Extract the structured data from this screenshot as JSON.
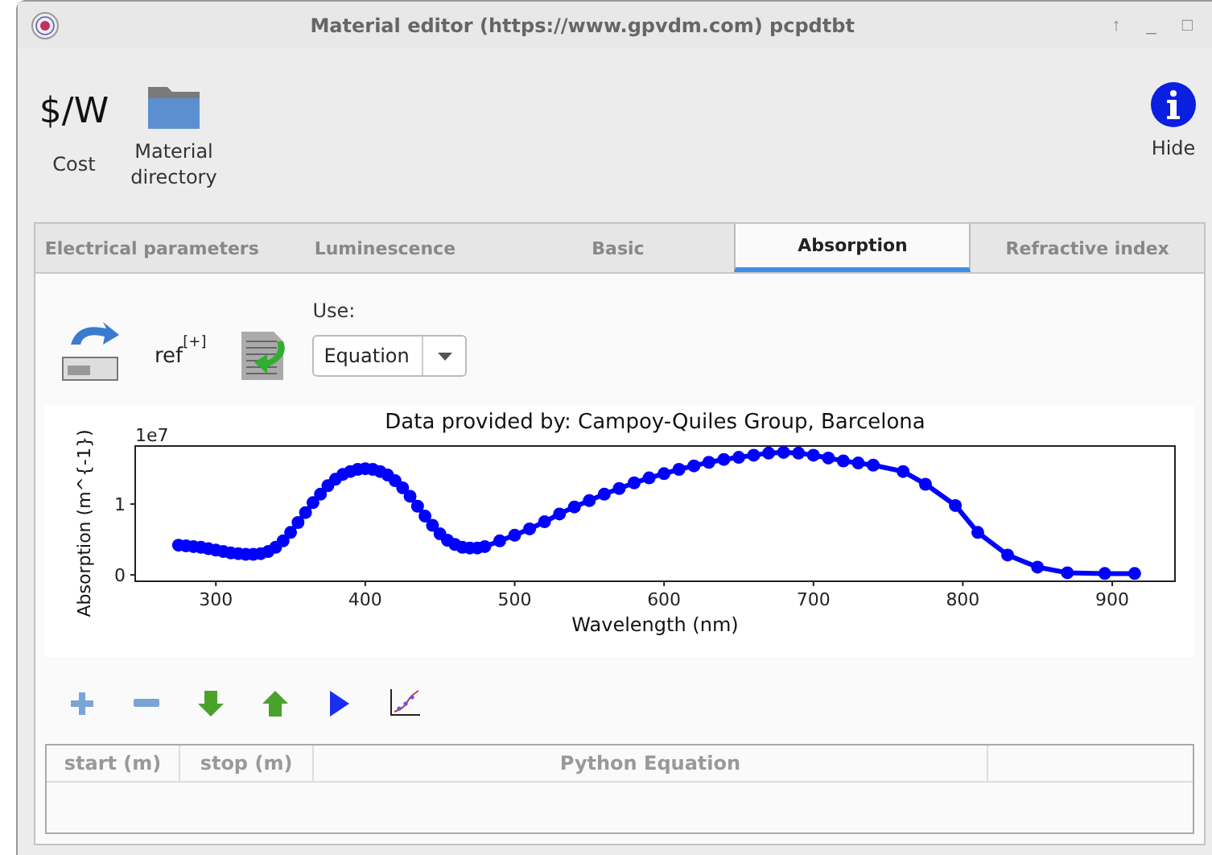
{
  "window": {
    "title": "Material editor (https://www.gpvdm.com) pcpdtbt",
    "controls": [
      "↑",
      "_",
      "□"
    ]
  },
  "toolbar": {
    "items": [
      {
        "kind": "text",
        "glyph": "$/W",
        "label": "Cost"
      },
      {
        "kind": "folder",
        "label": "Material\ndirectory"
      },
      {
        "kind": "info",
        "label": "Hide"
      }
    ]
  },
  "tabs": [
    {
      "label": "Electrical parameters",
      "selected": false
    },
    {
      "label": "Luminescence",
      "selected": false
    },
    {
      "label": "Basic",
      "selected": false
    },
    {
      "label": "Absorption",
      "selected": true
    },
    {
      "label": "Refractive index",
      "selected": false
    }
  ],
  "absorption": {
    "ref": {
      "label": "ref",
      "mark": "[+]"
    },
    "use": {
      "label": "Use:",
      "value": "Equation"
    },
    "chart_data": {
      "type": "line",
      "title": "Data provided by: Campoy-Quiles Group, Barcelona",
      "xlabel": "Wavelength (nm)",
      "ylabel": "Absorption (m^{-1})",
      "xlim": [
        246,
        942
      ],
      "ylim": [
        -0.09,
        1.82
      ],
      "xticks": [
        300,
        400,
        500,
        600,
        700,
        800,
        900
      ],
      "yticks": [
        {
          "value": 0,
          "label": "0"
        },
        {
          "value": 1,
          "label": "1"
        }
      ],
      "annotations": [
        "1e7"
      ],
      "x": [
        275,
        280,
        285,
        290,
        295,
        300,
        305,
        310,
        315,
        320,
        325,
        330,
        335,
        340,
        345,
        350,
        355,
        360,
        365,
        370,
        375,
        380,
        385,
        390,
        395,
        400,
        405,
        410,
        415,
        420,
        425,
        430,
        435,
        440,
        445,
        450,
        455,
        460,
        465,
        470,
        475,
        480,
        490,
        500,
        510,
        520,
        530,
        540,
        550,
        560,
        570,
        580,
        590,
        600,
        610,
        620,
        630,
        640,
        650,
        660,
        670,
        680,
        690,
        700,
        710,
        720,
        730,
        740,
        760,
        775,
        795,
        810,
        830,
        850,
        870,
        895,
        915
      ],
      "series": [
        {
          "color": "#0000ff",
          "marker": "o",
          "values": [
            0.42,
            0.41,
            0.4,
            0.39,
            0.37,
            0.35,
            0.33,
            0.31,
            0.3,
            0.29,
            0.29,
            0.3,
            0.33,
            0.39,
            0.48,
            0.6,
            0.74,
            0.88,
            1.02,
            1.14,
            1.26,
            1.35,
            1.42,
            1.46,
            1.49,
            1.5,
            1.49,
            1.46,
            1.41,
            1.33,
            1.23,
            1.11,
            0.97,
            0.83,
            0.7,
            0.58,
            0.49,
            0.43,
            0.39,
            0.38,
            0.38,
            0.4,
            0.48,
            0.56,
            0.65,
            0.75,
            0.86,
            0.96,
            1.05,
            1.14,
            1.22,
            1.3,
            1.37,
            1.43,
            1.49,
            1.54,
            1.59,
            1.63,
            1.66,
            1.69,
            1.72,
            1.73,
            1.72,
            1.69,
            1.65,
            1.61,
            1.58,
            1.55,
            1.46,
            1.28,
            0.98,
            0.6,
            0.28,
            0.11,
            0.03,
            0.02,
            0.02
          ]
        }
      ]
    },
    "tools": [
      {
        "kind": "add"
      },
      {
        "kind": "remove"
      },
      {
        "kind": "down"
      },
      {
        "kind": "up"
      },
      {
        "kind": "run"
      },
      {
        "kind": "fit"
      }
    ],
    "table": {
      "columns": [
        "start (m)",
        "stop (m)",
        "Python Equation"
      ]
    }
  }
}
